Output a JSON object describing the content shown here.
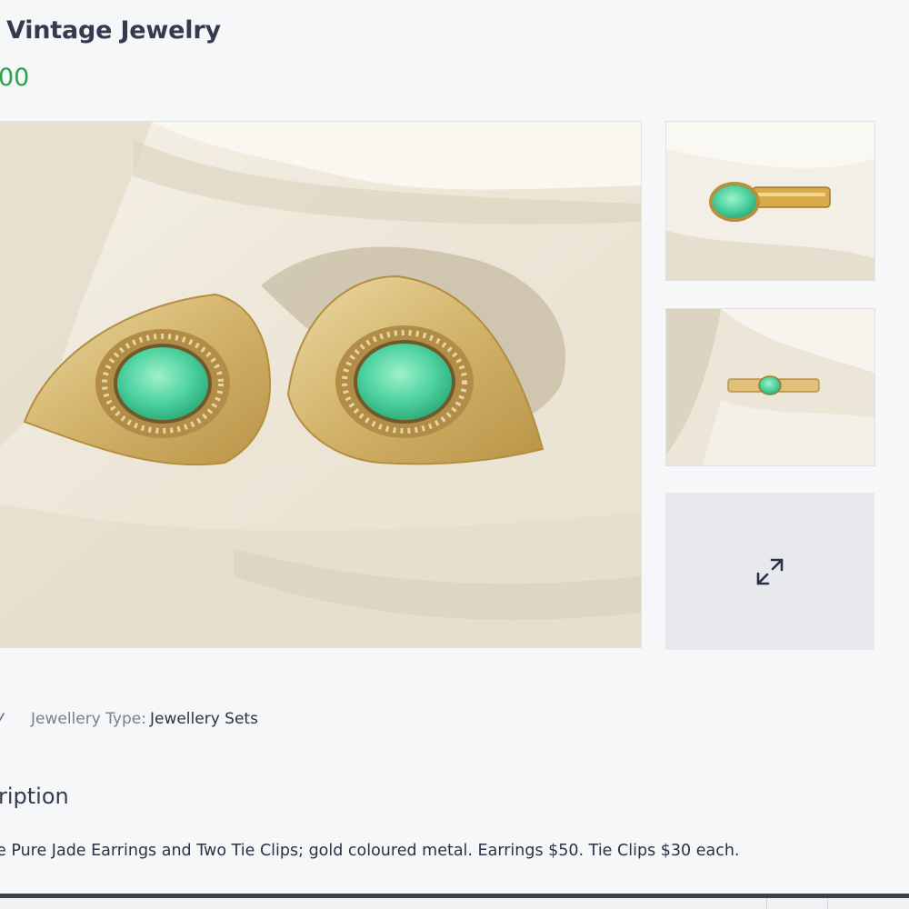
{
  "listing": {
    "title": "Vintage Jewelry",
    "price": "00"
  },
  "gallery": {
    "main_image_icon": "earrings-photo",
    "thumbnails": [
      {
        "icon": "tie-clip-photo"
      },
      {
        "icon": "tie-clip-photo"
      }
    ],
    "expand_icon": "expand-arrows-icon"
  },
  "attributes": {
    "type_key": "Jewellery Type:",
    "type_value": "Jewellery Sets"
  },
  "description": {
    "heading": "ription",
    "text": "e Pure Jade Earrings and Two Tie Clips; gold coloured metal. Earrings $50. Tie Clips $30 each."
  },
  "colors": {
    "price": "#2aa24b",
    "text": "#2c3245",
    "muted": "#7a7f8c",
    "background": "#f6f7f8"
  }
}
